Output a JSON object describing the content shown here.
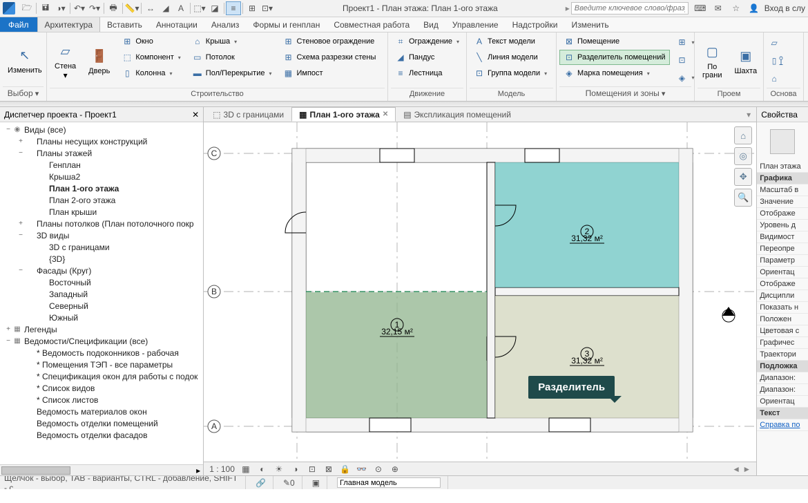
{
  "qat": {
    "title": "Проект1 - План этажа: План 1-ого этажа",
    "search_ph": "Введите ключевое слово/фразу",
    "signin": "Вход в слу"
  },
  "menu": {
    "file": "Файл",
    "tabs": [
      "Архитектура",
      "Вставить",
      "Аннотации",
      "Анализ",
      "Формы и генплан",
      "Совместная работа",
      "Вид",
      "Управление",
      "Надстройки",
      "Изменить"
    ]
  },
  "ribbon": {
    "p_select": {
      "label": "Выбор",
      "modify": "Изменить"
    },
    "p_build": {
      "label": "Строительство",
      "wall": "Стена",
      "door": "Дверь",
      "window": "Окно",
      "component": "Компонент",
      "column": "Колонна",
      "roof": "Крыша",
      "ceiling": "Потолок",
      "floor": "Пол/Перекрытие",
      "curtain": "Стеновое ограждение",
      "grid": "Схема разрезки стены",
      "mullion": "Импост"
    },
    "p_circ": {
      "label": "Движение",
      "railing": "Ограждение",
      "ramp": "Пандус",
      "stair": "Лестница"
    },
    "p_model": {
      "label": "Модель",
      "text": "Текст модели",
      "line": "Линия  модели",
      "group": "Группа модели"
    },
    "p_room": {
      "label": "Помещения и зоны",
      "room": "Помещение",
      "sep": "Разделитель помещений",
      "tag": "Марка помещения"
    },
    "p_open": {
      "label": "Проем",
      "face": "По грани",
      "shaft": "Шахта"
    },
    "p_datum": {
      "label": "Основа"
    }
  },
  "browser": {
    "title": "Диспетчер проекта - Проект1",
    "items": [
      {
        "d": 0,
        "e": "−",
        "i": "◉",
        "t": "Виды (все)"
      },
      {
        "d": 1,
        "e": "+",
        "i": "",
        "t": "Планы несущих конструкций"
      },
      {
        "d": 1,
        "e": "−",
        "i": "",
        "t": "Планы этажей"
      },
      {
        "d": 2,
        "e": "",
        "i": "",
        "t": "Генплан"
      },
      {
        "d": 2,
        "e": "",
        "i": "",
        "t": "Крыша2"
      },
      {
        "d": 2,
        "e": "",
        "i": "",
        "t": "План 1-ого этажа",
        "b": true
      },
      {
        "d": 2,
        "e": "",
        "i": "",
        "t": "План 2-ого этажа"
      },
      {
        "d": 2,
        "e": "",
        "i": "",
        "t": "План крыши"
      },
      {
        "d": 1,
        "e": "+",
        "i": "",
        "t": "Планы потолков (План потолочного покр"
      },
      {
        "d": 1,
        "e": "−",
        "i": "",
        "t": "3D виды"
      },
      {
        "d": 2,
        "e": "",
        "i": "",
        "t": "3D с границами"
      },
      {
        "d": 2,
        "e": "",
        "i": "",
        "t": "{3D}"
      },
      {
        "d": 1,
        "e": "−",
        "i": "",
        "t": "Фасады (Круг)"
      },
      {
        "d": 2,
        "e": "",
        "i": "",
        "t": "Восточный"
      },
      {
        "d": 2,
        "e": "",
        "i": "",
        "t": "Западный"
      },
      {
        "d": 2,
        "e": "",
        "i": "",
        "t": "Северный"
      },
      {
        "d": 2,
        "e": "",
        "i": "",
        "t": "Южный"
      },
      {
        "d": 0,
        "e": "+",
        "i": "▦",
        "t": "Легенды"
      },
      {
        "d": 0,
        "e": "−",
        "i": "▦",
        "t": "Ведомости/Спецификации (все)"
      },
      {
        "d": 1,
        "e": "",
        "i": "",
        "t": "* Ведомость подоконников - рабочая"
      },
      {
        "d": 1,
        "e": "",
        "i": "",
        "t": "* Помещения ТЭП - все параметры"
      },
      {
        "d": 1,
        "e": "",
        "i": "",
        "t": "* Спецификация окон для работы с подок"
      },
      {
        "d": 1,
        "e": "",
        "i": "",
        "t": "* Список видов"
      },
      {
        "d": 1,
        "e": "",
        "i": "",
        "t": "* Список листов"
      },
      {
        "d": 1,
        "e": "",
        "i": "",
        "t": "Ведомость материалов окон"
      },
      {
        "d": 1,
        "e": "",
        "i": "",
        "t": "Ведомость отделки помещений"
      },
      {
        "d": 1,
        "e": "",
        "i": "",
        "t": "Ведомость отделки фасадов"
      }
    ]
  },
  "viewtabs": {
    "t1": "3D с границами",
    "t2": "План 1-ого этажа",
    "t3": "Экспликация помещений"
  },
  "rooms": {
    "r1": {
      "n": "1",
      "a": "32,15 м²"
    },
    "r2": {
      "n": "2",
      "a": "31,32 м²"
    },
    "r3": {
      "n": "3",
      "a": "31,32 м²"
    }
  },
  "grids": {
    "a": "A",
    "b": "B",
    "c": "C"
  },
  "tooltip": "Разделитель",
  "vctrl": {
    "scale": "1 : 100"
  },
  "props": {
    "title": "Свойства",
    "type": "План этажа",
    "g1": "Графика",
    "r": [
      "Масштаб в",
      "Значение",
      "Отображе",
      "Уровень д",
      "Видимост",
      "Переопре",
      "Параметр",
      "Ориентац",
      "Отображе",
      "Дисципли",
      "Показать н",
      "Положен",
      "Цветовая с",
      "Графичес",
      "Траектори"
    ],
    "g2": "Подложка",
    "r2": [
      "Диапазон:",
      "Диапазон:",
      "Ориентац"
    ],
    "g3": "Текст",
    "help": "Справка по"
  },
  "status": {
    "hint": "Щелчок - выбор, TAB - варианты, CTRL - добавление, SHIFT - с",
    "n": "0",
    "model": "Главная модель"
  }
}
